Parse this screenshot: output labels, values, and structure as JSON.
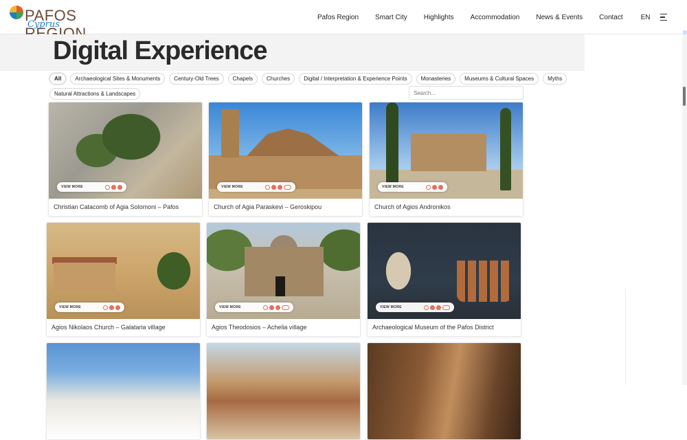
{
  "header": {
    "logo_text": "PAFOS REGION",
    "logo_sub": "Cyprus",
    "nav": [
      "Pafos Region",
      "Smart City",
      "Highlights",
      "Accommodation",
      "News & Events",
      "Contact"
    ],
    "lang": "EN"
  },
  "page": {
    "title": "Digital Experience"
  },
  "filters": {
    "row1": [
      "All",
      "Archaeological Sites & Monuments",
      "Century-Old Trees",
      "Chapels",
      "Churches",
      "Digital / Interpretation & Experience Points",
      "Monasteries",
      "Museums & Cultural Spaces",
      "Myths"
    ],
    "row2": [
      "Natural Attractions & Landscapes"
    ],
    "active": "All"
  },
  "search": {
    "placeholder": "Search..."
  },
  "cards": [
    {
      "title": "Christian Catacomb of Agia Solomoni – Pafos",
      "view_more": "VIEW MORE"
    },
    {
      "title": "Church of Agia Paraskevi – Geroskipou",
      "view_more": "VIEW MORE"
    },
    {
      "title": "Church of Agios Andronikos",
      "view_more": "VIEW MORE"
    },
    {
      "title": "Agios Nikolaos Church – Galataria village",
      "view_more": "VIEW MORE"
    },
    {
      "title": "Agios Theodosios – Achelia village",
      "view_more": "VIEW MORE"
    },
    {
      "title": "Archaeological Museum of the Pafos District",
      "view_more": "VIEW MORE"
    },
    {
      "title": "",
      "view_more": ""
    },
    {
      "title": "",
      "view_more": ""
    },
    {
      "title": "",
      "view_more": ""
    }
  ]
}
